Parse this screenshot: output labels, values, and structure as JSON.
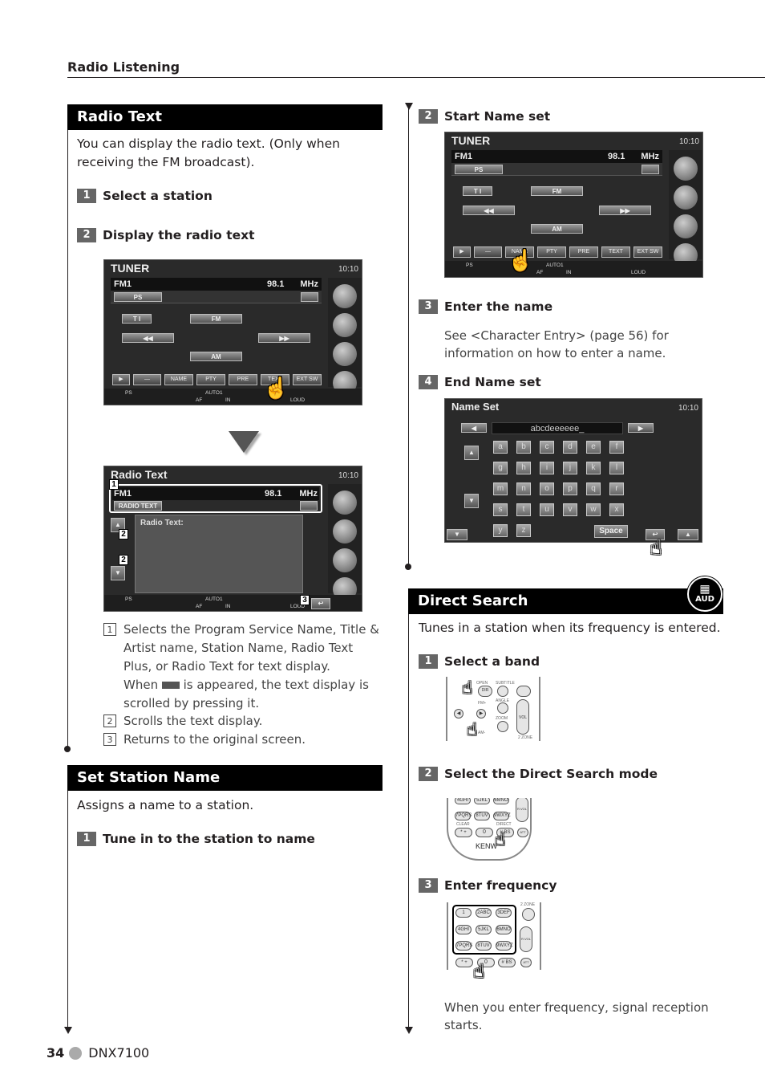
{
  "header": {
    "section": "Radio Listening"
  },
  "radio_text": {
    "title": "Radio Text",
    "intro": "You can display the radio text. (Only when receiving the FM broadcast).",
    "steps": [
      {
        "num": "1",
        "label": "Select a station"
      },
      {
        "num": "2",
        "label": "Display the radio text"
      }
    ],
    "tuner_screen": {
      "title": "TUNER",
      "clock": "10:10",
      "band": "FM1",
      "freq": "98.1",
      "unit": "MHz",
      "ps_label": "PS",
      "ti": "T I",
      "fm": "FM",
      "prev": "◀◀",
      "next": "▶▶",
      "am": "AM",
      "bottom_buttons": [
        "▶",
        "—",
        "NAME",
        "PTY",
        "PRE",
        "TEXT",
        "EXT SW"
      ],
      "status": {
        "ps": "PS",
        "auto": "AUTO1",
        "af": "AF",
        "in": "IN",
        "loud": "LOUD"
      }
    },
    "radio_text_screen": {
      "title": "Radio Text",
      "clock": "10:10",
      "band": "FM1",
      "freq": "98.1",
      "unit": "MHz",
      "mode_button": "RADIO TEXT",
      "text_label": "Radio Text:",
      "callouts": [
        "1",
        "2",
        "2",
        "3"
      ],
      "status": {
        "ps": "PS",
        "auto": "AUTO1",
        "af": "AF",
        "in": "IN",
        "loud": "LOUD"
      }
    },
    "legend": [
      {
        "num": "1",
        "text": "Selects the Program Service Name, Title & Artist name, Station Name, Radio Text Plus, or Radio Text for text display.",
        "text2a": "When",
        "text2b": "is appeared, the text display is scrolled by pressing it."
      },
      {
        "num": "2",
        "text": "Scrolls the text display."
      },
      {
        "num": "3",
        "text": "Returns to the original screen."
      }
    ]
  },
  "set_station_name": {
    "title": "Set Station Name",
    "intro": "Assigns a name to a station.",
    "steps": [
      {
        "num": "1",
        "label": "Tune in to the station to name"
      },
      {
        "num": "2",
        "label": "Start Name set"
      },
      {
        "num": "3",
        "label": "Enter the name",
        "note": "See <Character Entry> (page 56) for information on how to enter a name."
      },
      {
        "num": "4",
        "label": "End Name set"
      }
    ],
    "name_set_screen": {
      "title": "Name Set",
      "clock": "10:10",
      "entry": "abcdeeeeee_",
      "keys": [
        "a",
        "b",
        "c",
        "d",
        "e",
        "f",
        "g",
        "h",
        "i",
        "j",
        "k",
        "l",
        "m",
        "n",
        "o",
        "p",
        "q",
        "r",
        "s",
        "t",
        "u",
        "v",
        "w",
        "x",
        "y",
        "z"
      ],
      "space": "Space"
    }
  },
  "direct_search": {
    "title": "Direct Search",
    "badge": "AUD",
    "intro": "Tunes in a station when its frequency is entered.",
    "steps": [
      {
        "num": "1",
        "label": "Select a band"
      },
      {
        "num": "2",
        "label": "Select the Direct Search mode"
      },
      {
        "num": "3",
        "label": "Enter frequency"
      }
    ],
    "remote1": {
      "labels": [
        "OPEN",
        "SUBTITLE",
        "DIR",
        "FM+",
        "ANGLE",
        "ZOOM",
        "AM-",
        "VOL",
        "2 ZONE"
      ]
    },
    "remote2": {
      "keys": [
        "4GHI",
        "5JKL",
        "6MNO",
        "7PQRS",
        "8TUV",
        "9WXYZ",
        "* +",
        "0",
        "# BS",
        "ATT"
      ],
      "labels": [
        "CLEAR",
        "DIRECT",
        "R.VOL",
        "KENW"
      ]
    },
    "remote3": {
      "keys": [
        "1",
        "2ABC",
        "3DEF",
        "4GHI",
        "5JKL",
        "6MNO",
        "7PQRS",
        "8TUV",
        "9WXYZ",
        "* +",
        "0",
        "# BS",
        "ATT"
      ],
      "labels": [
        "2 ZONE",
        "R.VOL"
      ]
    },
    "outro": "When you enter frequency, signal reception starts."
  },
  "footer": {
    "page": "34",
    "model": "DNX7100"
  }
}
